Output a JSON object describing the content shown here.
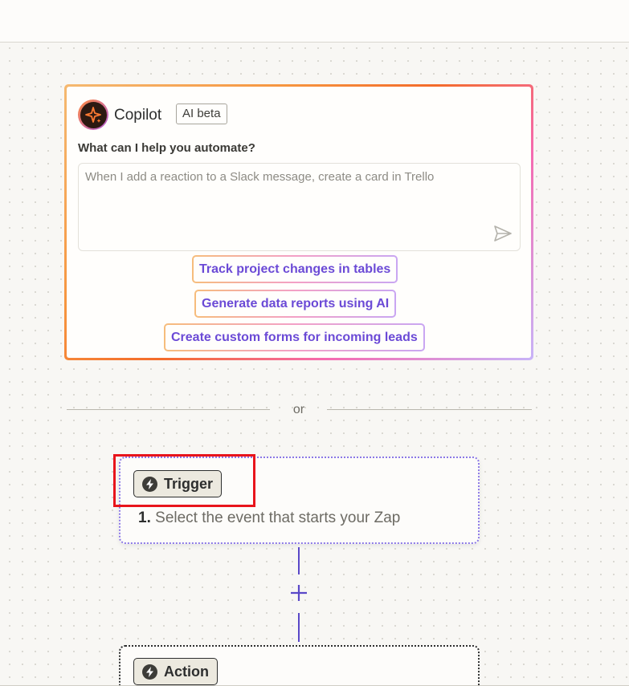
{
  "copilot": {
    "title": "Copilot",
    "badge": "AI beta",
    "question": "What can I help you automate?",
    "input_placeholder": "When I add a reaction to a Slack message, create a card in Trello",
    "input_value": "",
    "suggestions": [
      "Track project changes in tables",
      "Generate data reports using AI",
      "Create custom forms for incoming leads"
    ],
    "colors": {
      "gradient_start": "#f5b971",
      "gradient_mid": "#f46b2a",
      "gradient_end": "#c8b4f8",
      "suggestion_text": "#6b4ad6"
    }
  },
  "divider": {
    "text": "or"
  },
  "trigger": {
    "label": "Trigger",
    "step_number": "1.",
    "description": "Select the event that starts your Zap"
  },
  "action": {
    "label": "Action"
  },
  "icons": {
    "copilot_logo": "sparkle-icon",
    "send": "send-icon",
    "trigger_bolt": "bolt-icon",
    "action_bolt": "bolt-icon",
    "add_step": "plus-icon"
  },
  "colors": {
    "accent": "#5a48c8",
    "highlight": "#e8141b",
    "background": "#f8f7f4"
  }
}
